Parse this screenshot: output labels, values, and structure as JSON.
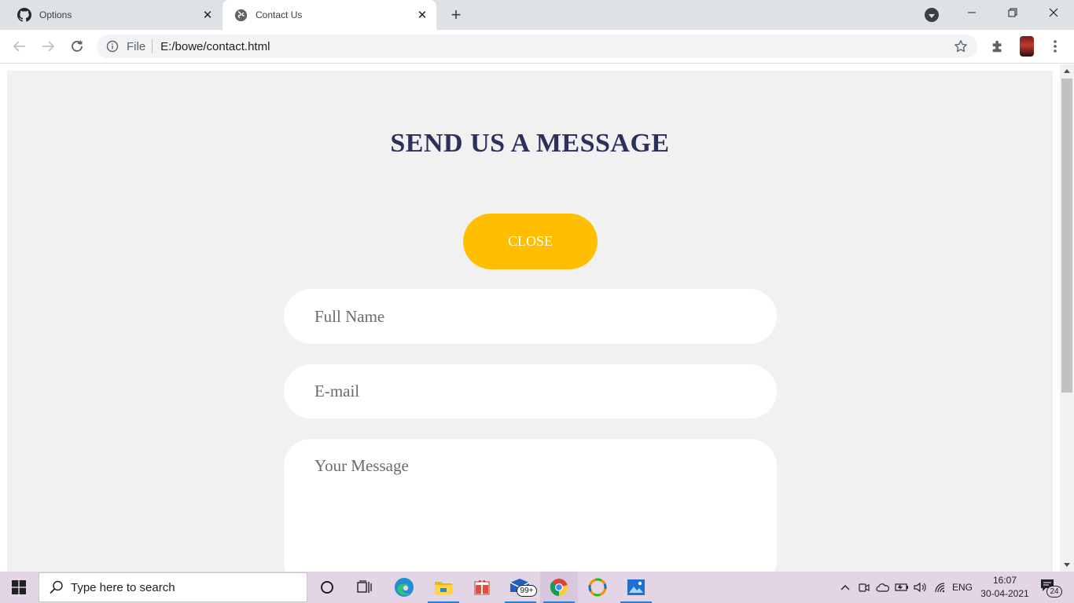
{
  "browser": {
    "tabs": [
      {
        "title": "Options",
        "favicon": "github-icon",
        "active": false
      },
      {
        "title": "Contact Us",
        "favicon": "globe-icon",
        "active": true
      }
    ],
    "address": {
      "scheme": "File",
      "url": "E:/bowe/contact.html"
    }
  },
  "page": {
    "heading": "SEND US A MESSAGE",
    "close_label": "CLOSE",
    "name_placeholder": "Full Name",
    "email_placeholder": "E-mail",
    "message_placeholder": "Your Message",
    "colors": {
      "heading": "#2d2f5c",
      "button": "#ffbf00",
      "background": "#f1f1f1"
    }
  },
  "taskbar": {
    "search_placeholder": "Type here to search",
    "mail_badge": "99+",
    "language": "ENG",
    "time": "16:07",
    "date": "30-04-2021",
    "notification_count": "24"
  }
}
